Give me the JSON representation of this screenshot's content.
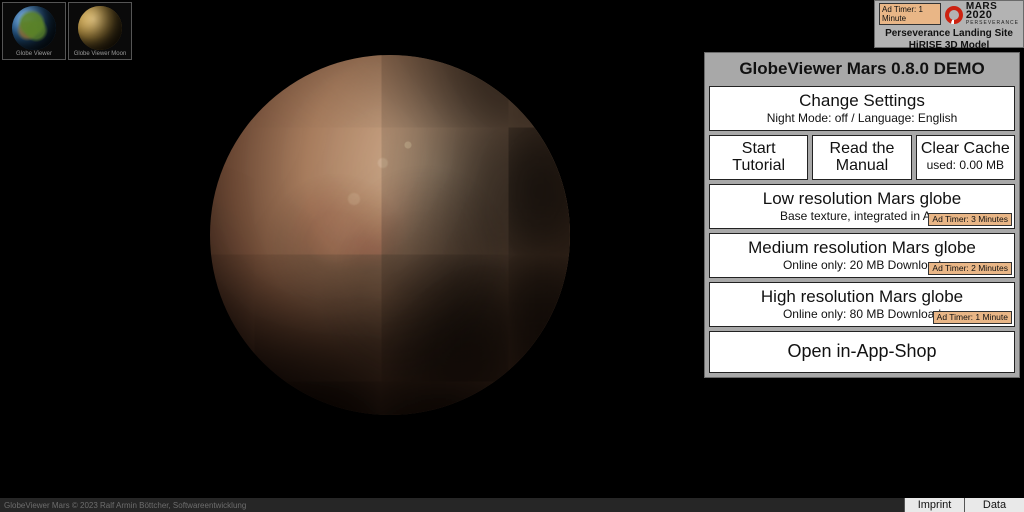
{
  "thumbs": {
    "earth": {
      "label": "Globe Viewer"
    },
    "moon": {
      "label": "Globe Viewer Moon"
    }
  },
  "promo": {
    "ad_timer": "Ad Timer: 1 Minute",
    "brand_line1": "MARS",
    "brand_line2": "2020",
    "brand_sub": "PERSEVERANCE",
    "caption_line1": "Perseverance Landing Site",
    "caption_line2": "HiRISE 3D Model"
  },
  "panel": {
    "title": "GlobeViewer Mars 0.8.0 DEMO",
    "settings": {
      "label": "Change Settings",
      "sub": "Night Mode: off / Language: English"
    },
    "tutorial": {
      "line1": "Start",
      "line2": "Tutorial"
    },
    "manual": {
      "line1": "Read the",
      "line2": "Manual"
    },
    "cache": {
      "label": "Clear Cache",
      "sub": "used: 0.00 MB"
    },
    "low": {
      "label": "Low resolution Mars globe",
      "sub": "Base texture, integrated in App",
      "ad": "Ad Timer: 3 Minutes"
    },
    "med": {
      "label": "Medium resolution Mars globe",
      "sub": "Online only: 20 MB Download",
      "ad": "Ad Timer: 2 Minutes"
    },
    "high": {
      "label": "High resolution Mars globe",
      "sub": "Online only: 80 MB Download",
      "ad": "Ad Timer: 1 Minute"
    },
    "shop": {
      "label": "Open in-App-Shop"
    }
  },
  "footer": {
    "copyright": "GlobeViewer Mars © 2023 Ralf Armin Böttcher, Softwareentwicklung",
    "imprint": "Imprint",
    "data": "Data"
  }
}
